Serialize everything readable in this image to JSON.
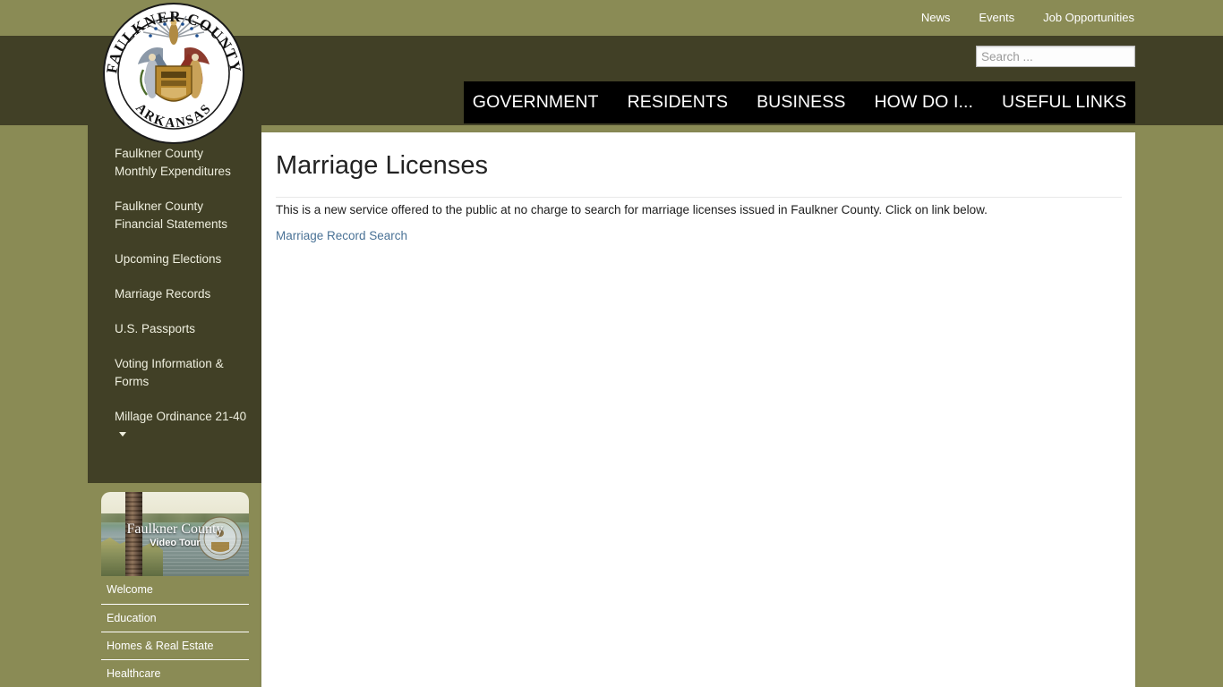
{
  "topbar": {
    "links": [
      {
        "label": "News",
        "name": "topbar-link-news"
      },
      {
        "label": "Events",
        "name": "topbar-link-events"
      },
      {
        "label": "Job Opportunities",
        "name": "topbar-link-job-opportunities"
      }
    ]
  },
  "search": {
    "placeholder": "Search ...",
    "value": ""
  },
  "mainnav": {
    "items": [
      {
        "label": "GOVERNMENT"
      },
      {
        "label": "RESIDENTS"
      },
      {
        "label": "BUSINESS"
      },
      {
        "label": "HOW DO I..."
      },
      {
        "label": "USEFUL LINKS"
      }
    ]
  },
  "seal": {
    "arc_top_text": "FAULKNER COUNTY",
    "arc_bottom_text": "ARKANSAS"
  },
  "sidebar": {
    "items": [
      {
        "label": "Faulkner County Monthly Expenditures",
        "has_caret": false
      },
      {
        "label": "Faulkner County Financial Statements",
        "has_caret": false
      },
      {
        "label": "Upcoming Elections",
        "has_caret": false
      },
      {
        "label": "Marriage Records",
        "has_caret": false
      },
      {
        "label": "U.S. Passports",
        "has_caret": false
      },
      {
        "label": "Voting Information & Forms",
        "has_caret": false
      },
      {
        "label": "Millage Ordinance 21-40",
        "has_caret": true
      }
    ]
  },
  "video_tour": {
    "banner_title": "Faulkner County",
    "banner_subtitle": "Video Tour",
    "rows": [
      {
        "label": "Welcome"
      },
      {
        "label": "Education"
      },
      {
        "label": "Homes & Real Estate"
      },
      {
        "label": "Healthcare"
      }
    ]
  },
  "main": {
    "title": "Marriage Licenses",
    "intro": "This is a new service offered to the public at no charge to search for marriage licenses issued in Faulkner County. Click on link below.",
    "link_label": "Marriage Record Search"
  },
  "colors": {
    "olive_light": "#8a8b55",
    "olive_dark": "#414026",
    "nav_black": "#000000",
    "link_blue": "#4a7296",
    "text_light": "#efefdf",
    "content_bg": "#ffffff"
  }
}
